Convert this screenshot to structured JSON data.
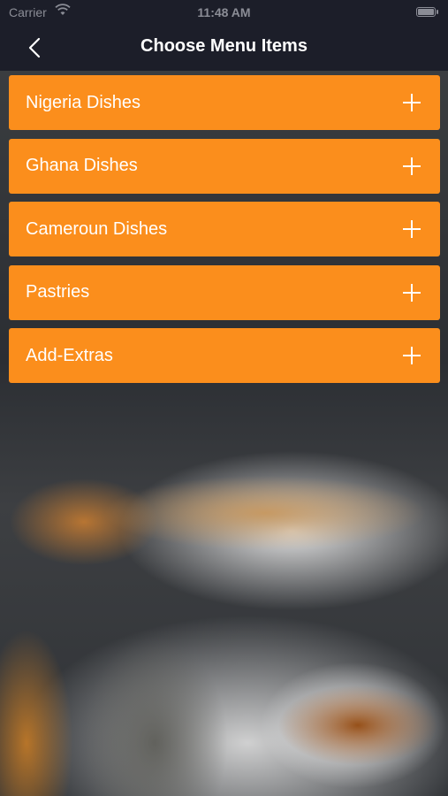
{
  "status_bar": {
    "carrier": "Carrier",
    "time": "11:48 AM"
  },
  "nav": {
    "title": "Choose Menu Items",
    "back_icon": "chevron-left-icon"
  },
  "colors": {
    "nav_background": "#1c1e29",
    "menu_item_background": "#fb8e1c",
    "menu_text": "#ffffff"
  },
  "menu": {
    "items": [
      {
        "label": "Nigeria Dishes",
        "icon": "plus-icon"
      },
      {
        "label": "Ghana Dishes",
        "icon": "plus-icon"
      },
      {
        "label": "Cameroun Dishes",
        "icon": "plus-icon"
      },
      {
        "label": "Pastries",
        "icon": "plus-icon"
      },
      {
        "label": "Add-Extras",
        "icon": "plus-icon"
      }
    ]
  }
}
